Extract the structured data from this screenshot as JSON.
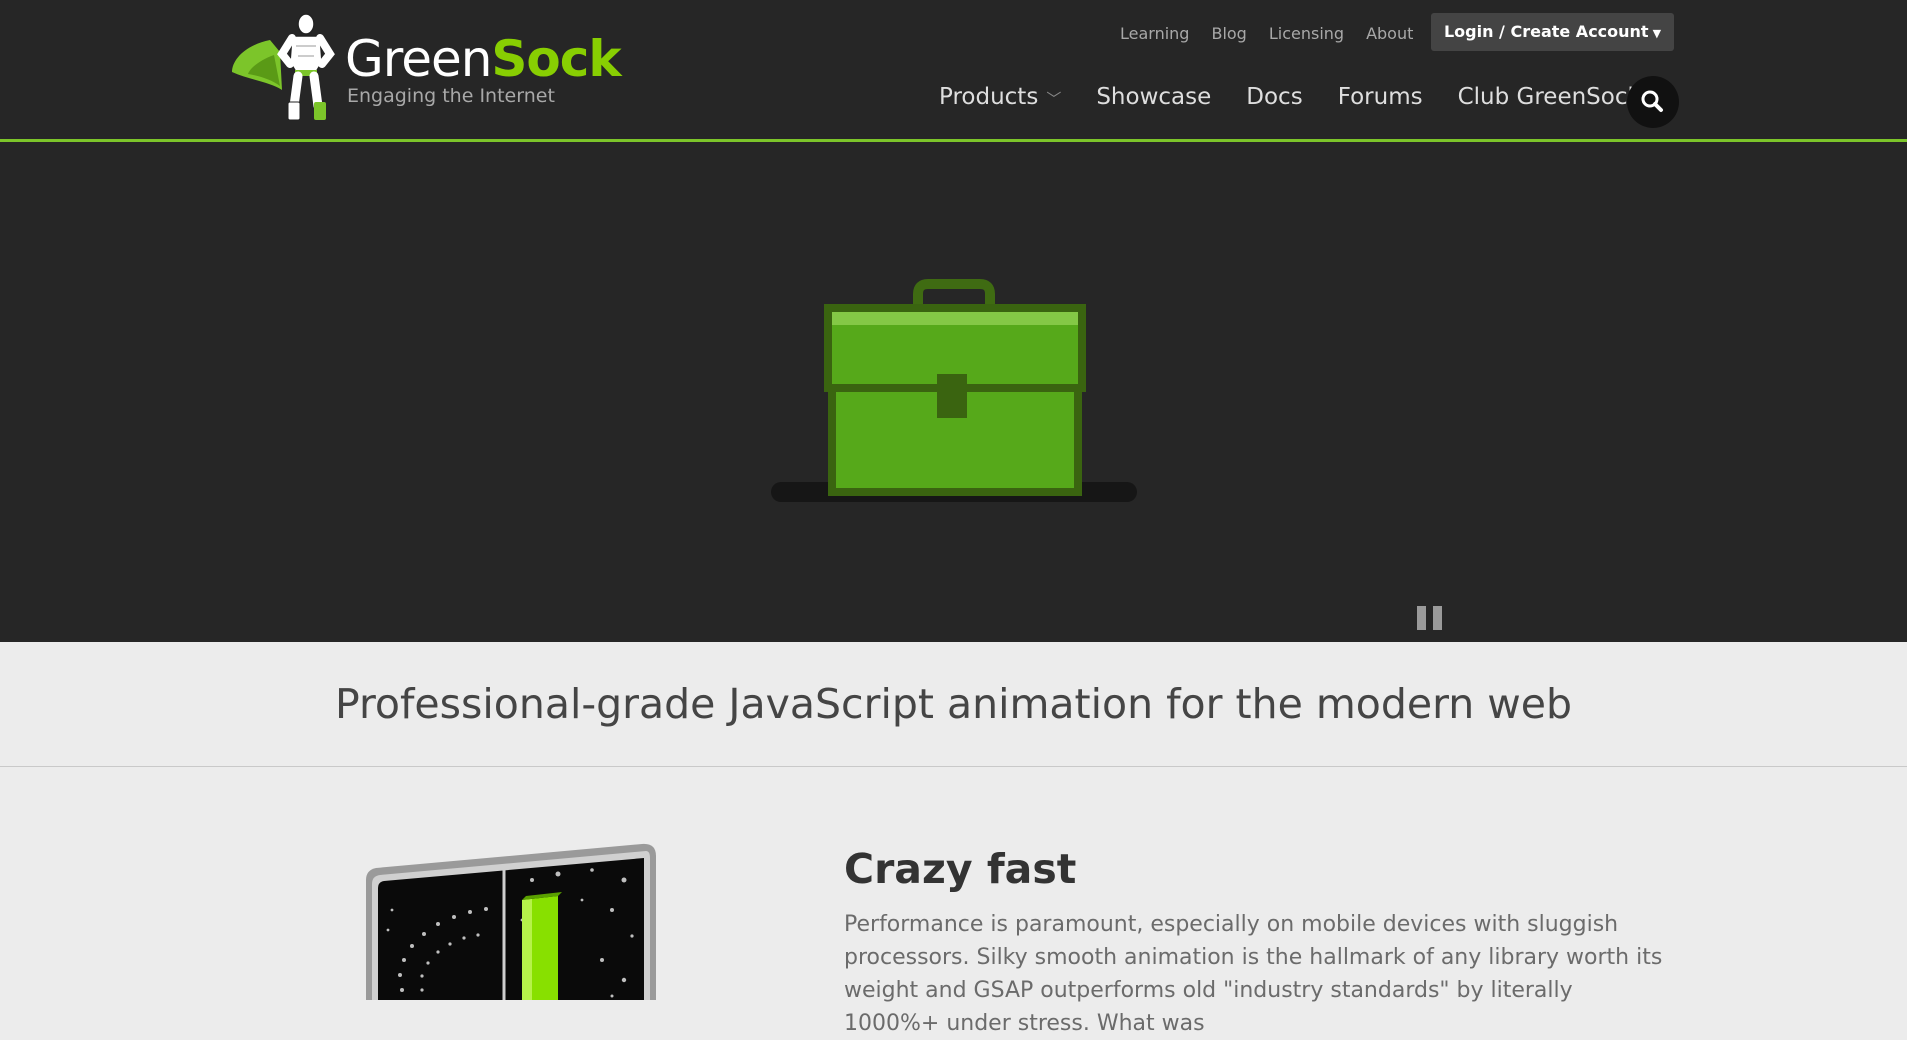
{
  "brand": {
    "name_part1": "Green",
    "name_part2": "Sock",
    "tagline": "Engaging the Internet",
    "accent_color": "#88ce02"
  },
  "top_nav": {
    "links": [
      "Learning",
      "Blog",
      "Licensing",
      "About"
    ],
    "login_label": "Login / Create Account"
  },
  "main_nav": {
    "items": [
      "Products",
      "Showcase",
      "Docs",
      "Forums",
      "Club GreenSock"
    ]
  },
  "icons": {
    "search": "search-icon",
    "pause": "pause-icon",
    "products_dropdown": "chevron-down-icon",
    "login_dropdown": "caret-down-icon"
  },
  "hero": {
    "illustration": "briefcase-icon"
  },
  "tagline": "Professional-grade JavaScript animation for the modern web",
  "feature": {
    "title": "Crazy fast",
    "text": "Performance is paramount, especially on mobile devices with sluggish processors. Silky smooth animation is the hallmark of any library worth its weight and GSAP outperforms old \"industry standards\" by literally 1000%+ under stress. What was"
  }
}
